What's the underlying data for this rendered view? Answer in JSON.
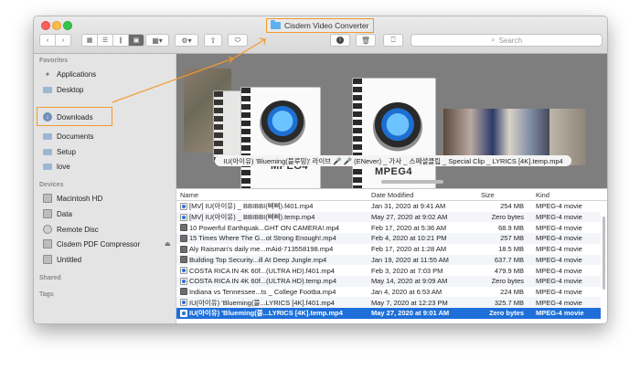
{
  "window": {
    "title": "Cisdem Video Converter"
  },
  "toolbar": {
    "back_icon": "chevron-left",
    "forward_icon": "chevron-right",
    "view_icons": [
      "icon-view",
      "list-view",
      "column-view",
      "cover-flow-view"
    ],
    "arrange_icon": "arrange-grid",
    "action_icon": "gear",
    "share_icon": "share",
    "tag_icon": "tag",
    "info_icon": "info",
    "trash_icon": "trash",
    "connect_icon": "connect-server",
    "search_placeholder": "Search"
  },
  "sidebar": {
    "favorites_heading": "Favorites",
    "favorites": [
      {
        "label": "Applications",
        "icon": "applications-icon"
      },
      {
        "label": "Desktop",
        "icon": "desktop-icon"
      },
      {
        "label": "Downloads",
        "icon": "downloads-icon",
        "highlighted": true
      },
      {
        "label": "Documents",
        "icon": "documents-icon"
      },
      {
        "label": "Setup",
        "icon": "folder-icon"
      },
      {
        "label": "love",
        "icon": "folder-icon"
      }
    ],
    "devices_heading": "Devices",
    "devices": [
      {
        "label": "Macintosh HD",
        "icon": "disk-icon"
      },
      {
        "label": "Data",
        "icon": "disk-icon"
      },
      {
        "label": "Remote Disc",
        "icon": "disc-icon"
      },
      {
        "label": "Cisdem PDF Compressor",
        "icon": "disk-icon",
        "eject": "⏏"
      },
      {
        "label": "Untitled",
        "icon": "disk-icon"
      }
    ],
    "shared_heading": "Shared",
    "tags_heading": "Tags"
  },
  "preview": {
    "mpeg_label_1": "MPEG4",
    "mpeg_label_2": "MPEG4",
    "caption": "IU(아이유) 'Blueming(블루밍)' 라이브 🎤 🎤 (ENever) _ 가사 _ 스페셜클립 _ Special Clip _ LYRICS [4K].temp.mp4"
  },
  "table": {
    "columns": {
      "name": "Name",
      "date": "Date Modified",
      "size": "Size",
      "kind": "Kind"
    },
    "rows": [
      {
        "name": "[MV] IU(아이유) _ BBIBBI(삐삐).f401.mp4",
        "date": "Jan 31, 2020 at 9:41 AM",
        "size": "254 MB",
        "kind": "MPEG-4 movie",
        "icon": "blue"
      },
      {
        "name": "[MV] IU(아이유) _ BBIBBI(삐삐).temp.mp4",
        "date": "May 27, 2020 at 9:02 AM",
        "size": "Zero bytes",
        "kind": "MPEG-4 movie",
        "icon": "blue"
      },
      {
        "name": "10 Powerful Earthquak...GHT ON CAMERA!.mp4",
        "date": "Feb 17, 2020 at 5:36 AM",
        "size": "68.9 MB",
        "kind": "MPEG-4 movie",
        "icon": "img"
      },
      {
        "name": "15 Times Where The G...ot Strong Enough!.mp4",
        "date": "Feb 4, 2020 at 10:21 PM",
        "size": "257 MB",
        "kind": "MPEG-4 movie",
        "icon": "img"
      },
      {
        "name": "Aly Raisman's daily me...mAid-713558198.mp4",
        "date": "Feb 17, 2020 at 1:28 AM",
        "size": "18.5 MB",
        "kind": "MPEG-4 movie",
        "icon": "img"
      },
      {
        "name": "Building Top Security...ill At Deep Jungle.mp4",
        "date": "Jan 19, 2020 at 11:55 AM",
        "size": "637.7 MB",
        "kind": "MPEG-4 movie",
        "icon": "img"
      },
      {
        "name": "COSTA RICA IN 4K 60f...(ULTRA HD).f401.mp4",
        "date": "Feb 3, 2020 at 7:03 PM",
        "size": "479.9 MB",
        "kind": "MPEG-4 movie",
        "icon": "blue"
      },
      {
        "name": "COSTA RICA IN 4K 60f...(ULTRA HD).temp.mp4",
        "date": "May 14, 2020 at 9:09 AM",
        "size": "Zero bytes",
        "kind": "MPEG-4 movie",
        "icon": "blue"
      },
      {
        "name": "Indiana vs Tennessee...ts _ College Footba.mp4",
        "date": "Jan 4, 2020 at 6:53 AM",
        "size": "224 MB",
        "kind": "MPEG-4 movie",
        "icon": "img"
      },
      {
        "name": "IU(아이유) 'Blueming(블...LYRICS [4K].f401.mp4",
        "date": "May 7, 2020 at 12:23 PM",
        "size": "325.7 MB",
        "kind": "MPEG-4 movie",
        "icon": "blue"
      },
      {
        "name": "IU(아이유) 'Blueming(블...LYRICS [4K].temp.mp4",
        "date": "May 27, 2020 at 9:01 AM",
        "size": "Zero bytes",
        "kind": "MPEG-4 movie",
        "icon": "blue",
        "selected": true
      }
    ]
  },
  "colors": {
    "highlight": "#f29a2e",
    "selection": "#1e6fd9"
  }
}
